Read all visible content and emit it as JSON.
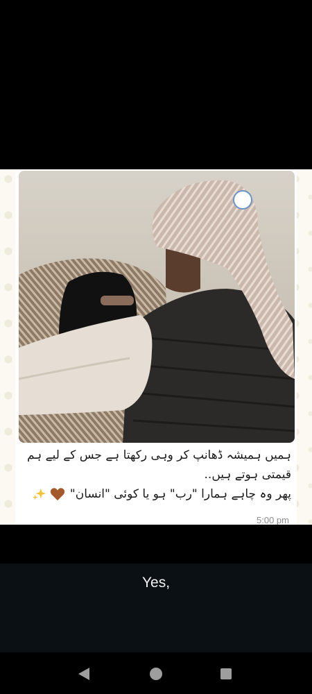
{
  "message": {
    "caption_lines": [
      "ہمیں ہمیشہ ڈھانپ کر وہی رکھتا ہے جس کے لیے ہم",
      "قیمتی ہوتے ہیں..",
      "پھر وہ چاہے ہمارا \"رب\" ہو یا کوئی \"انسان\""
    ],
    "emojis": [
      "brown-heart",
      "sparkles"
    ],
    "timestamp": "5:00 pm",
    "photo_subject": "couple-in-head-scarves"
  },
  "reply": {
    "text": "Yes,"
  },
  "nav": {
    "buttons": [
      "back",
      "home",
      "recents"
    ]
  },
  "colors": {
    "bubble": "#ffffff",
    "chat_background": "#fbf9f1",
    "reply_background": "#0b1014",
    "timestamp": "#8c8c8c"
  }
}
